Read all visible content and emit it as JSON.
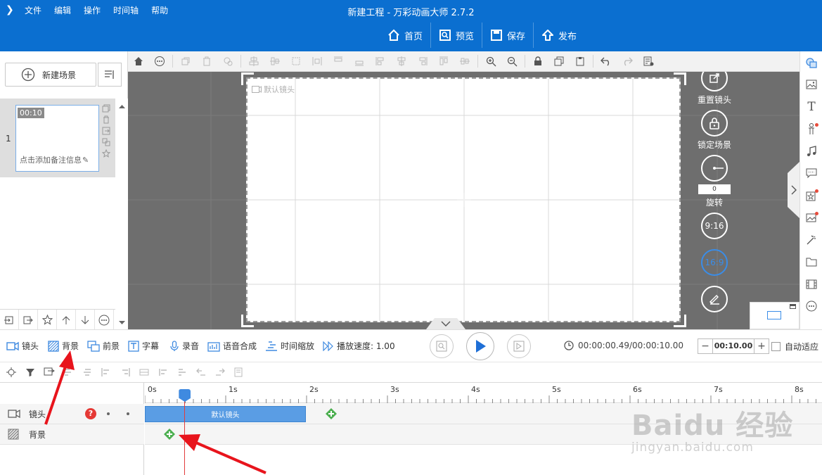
{
  "titlebar": {
    "title": "新建工程 - 万彩动画大师 2.7.2",
    "menu": [
      "文件",
      "编辑",
      "操作",
      "时间轴",
      "帮助"
    ],
    "actions": [
      {
        "label": "首页",
        "icon": "home-icon"
      },
      {
        "label": "预览",
        "icon": "preview-icon"
      },
      {
        "label": "保存",
        "icon": "save-icon"
      },
      {
        "label": "发布",
        "icon": "publish-icon"
      }
    ]
  },
  "scene_panel": {
    "new_scene_label": "新建场景",
    "scene": {
      "number": "1",
      "duration": "00:10",
      "note": "点击添加备注信息"
    }
  },
  "canvas": {
    "default_lens_label": "默认镜头",
    "side_tools": {
      "reset_label": "重置镜头",
      "lock_label": "锁定场景",
      "rotate_value": "0",
      "rotate_label": "旋转",
      "ratio_916": "9:16",
      "ratio_169": "16:9"
    }
  },
  "track_toolbar": {
    "buttons": [
      {
        "label": "镜头",
        "icon": "camera-icon"
      },
      {
        "label": "背景",
        "icon": "background-icon"
      },
      {
        "label": "前景",
        "icon": "foreground-icon"
      },
      {
        "label": "字幕",
        "icon": "subtitle-icon"
      },
      {
        "label": "录音",
        "icon": "microphone-icon"
      },
      {
        "label": "语音合成",
        "icon": "voice-synthesis-icon"
      },
      {
        "label": "时间缩放",
        "icon": "time-scale-icon"
      },
      {
        "label": "播放速度: 1.00",
        "icon": "speed-icon"
      }
    ],
    "time_readout": "00:00:00.49/00:00:10.00",
    "duration_value": "00:10.00",
    "autofit_label": "自动适应"
  },
  "timeline": {
    "ruler_ticks": [
      "0s",
      "1s",
      "2s",
      "3s",
      "4s",
      "5s",
      "6s",
      "7s",
      "8s"
    ],
    "tracks": [
      {
        "name": "镜头",
        "icon": "camera-icon",
        "help": "?"
      },
      {
        "name": "背景",
        "icon": "background-icon"
      }
    ],
    "lens_clip_label": "默认镜头",
    "playhead_seconds": 0.49
  },
  "watermark": {
    "logo": "Baidu 经验",
    "url": "jingyan.baidu.com"
  },
  "colors": {
    "titlebar": "#0b6fd0",
    "accent": "#3f8ae0",
    "annotation_red": "#e8141c",
    "add_key_green": "#4caf50"
  }
}
